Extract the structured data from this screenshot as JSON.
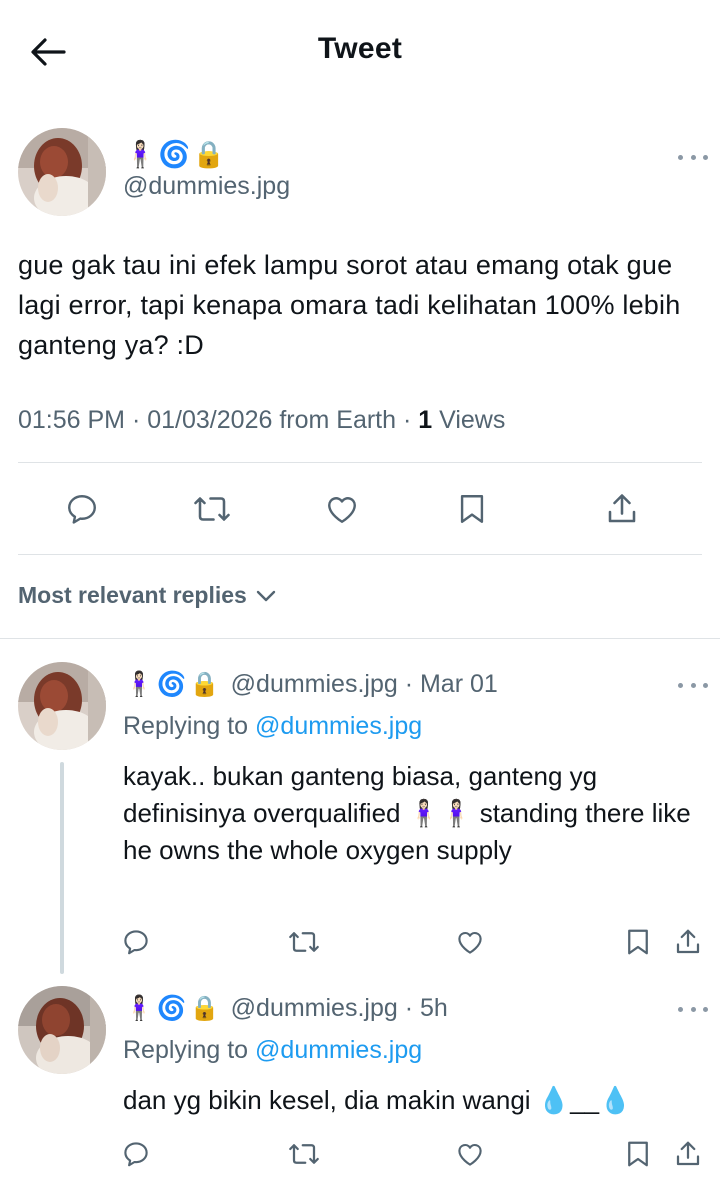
{
  "header": {
    "title": "Tweet",
    "back_icon": "arrow-left-icon"
  },
  "main_tweet": {
    "emojis": "🧍🏻‍♀️🌀🔒",
    "handle": "@dummies.jpg",
    "text": "gue gak tau ini efek lampu sorot atau emang otak gue lagi error, tapi kenapa omara tadi kelihatan 100% lebih ganteng ya? :D",
    "time": "01:56 PM",
    "date": "01/03/2026",
    "source": "from Earth",
    "views_count": "1",
    "views_label": "Views"
  },
  "sort": {
    "label": "Most relevant replies"
  },
  "replies": [
    {
      "emojis": "🧍🏻‍♀️🌀🔒",
      "handle": "@dummies.jpg",
      "time": "Mar 01",
      "replying_prefix": "Replying to",
      "replying_to": "@dummies.jpg",
      "text": "kayak.. bukan ganteng biasa, ganteng yg definisinya overqualified 🧍🏻‍♀️🧍🏻‍♀️ standing there like he owns the whole oxygen supply"
    },
    {
      "emojis": "🧍🏻‍♀️🌀🔒",
      "handle": "@dummies.jpg",
      "time": "5h",
      "replying_prefix": "Replying to",
      "replying_to": "@dummies.jpg",
      "text": "dan yg bikin kesel, dia makin wangi 💧__💧"
    }
  ],
  "colors": {
    "accent": "#1d9bf0",
    "secondary_text": "#536471",
    "primary_text": "#0f1419",
    "divider": "#dfe3e6"
  }
}
